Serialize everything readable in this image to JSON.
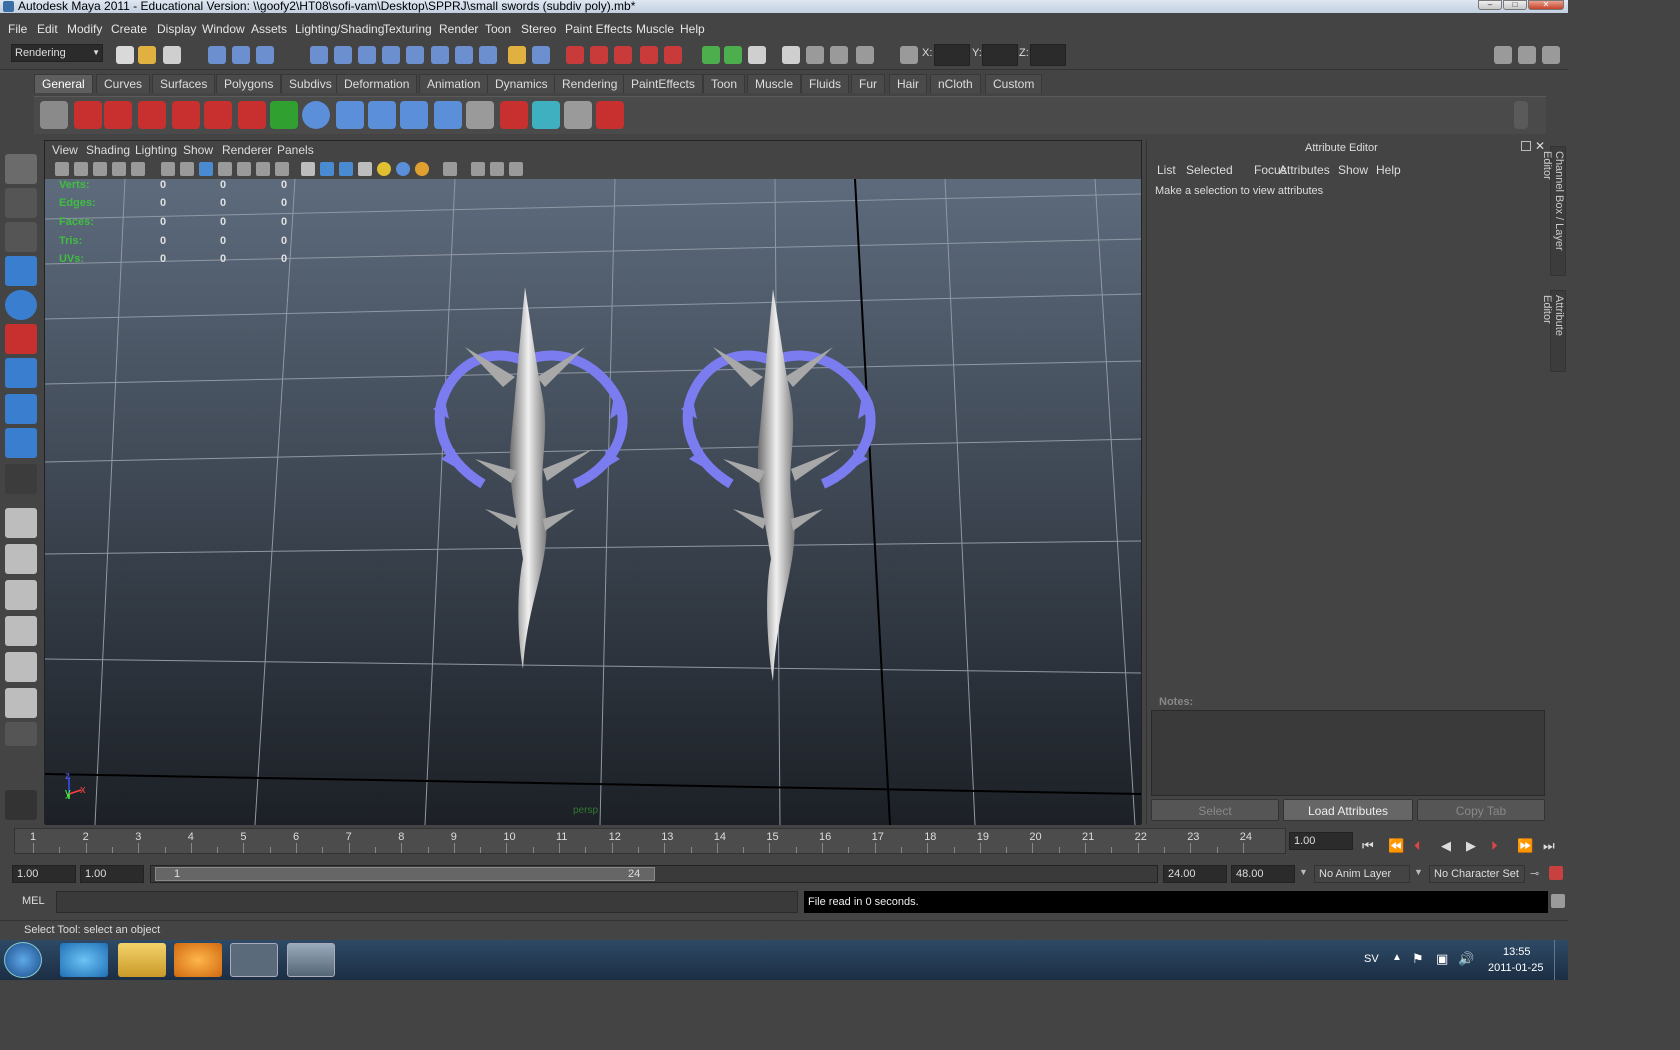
{
  "window": {
    "title": "Autodesk Maya 2011 - Educational Version: \\\\goofy2\\HT08\\sofi-vam\\Desktop\\SPPRJ\\small swords (subdiv poly).mb*"
  },
  "menu": [
    "File",
    "Edit",
    "Modify",
    "Create",
    "Display",
    "Window",
    "Assets",
    "Lighting/Shading",
    "Texturing",
    "Render",
    "Toon",
    "Stereo",
    "Paint Effects",
    "Muscle",
    "Help"
  ],
  "status_line": {
    "menu_set": "Rendering",
    "x_label": "X:",
    "y_label": "Y:",
    "z_label": "Z:"
  },
  "shelf_tabs": [
    "General",
    "Curves",
    "Surfaces",
    "Polygons",
    "Subdivs",
    "Deformation",
    "Animation",
    "Dynamics",
    "Rendering",
    "PaintEffects",
    "Toon",
    "Muscle",
    "Fluids",
    "Fur",
    "Hair",
    "nCloth",
    "Custom"
  ],
  "viewport": {
    "menu": [
      "View",
      "Shading",
      "Lighting",
      "Show",
      "Renderer",
      "Panels"
    ],
    "hud": {
      "rows": [
        {
          "label": "Verts:",
          "v1": "0",
          "v2": "0",
          "v3": "0"
        },
        {
          "label": "Edges:",
          "v1": "0",
          "v2": "0",
          "v3": "0"
        },
        {
          "label": "Faces:",
          "v1": "0",
          "v2": "0",
          "v3": "0"
        },
        {
          "label": "Tris:",
          "v1": "0",
          "v2": "0",
          "v3": "0"
        },
        {
          "label": "UVs:",
          "v1": "0",
          "v2": "0",
          "v3": "0"
        }
      ]
    },
    "camera": "persp",
    "axis": {
      "z": "z",
      "y": "y",
      "x": "x"
    }
  },
  "attribute_editor": {
    "title": "Attribute Editor",
    "menu": [
      "List",
      "Selected",
      "Focus",
      "Attributes",
      "Show",
      "Help"
    ],
    "message": "Make a selection to view attributes",
    "notes_label": "Notes:",
    "buttons": {
      "select": "Select",
      "load": "Load Attributes",
      "copy": "Copy Tab"
    }
  },
  "side_tabs": {
    "channel": "Channel Box / Layer Editor",
    "attribute": "Attribute Editor"
  },
  "timeline": {
    "ticks": [
      "1",
      "2",
      "3",
      "4",
      "5",
      "6",
      "7",
      "8",
      "9",
      "10",
      "11",
      "12",
      "13",
      "14",
      "15",
      "16",
      "17",
      "18",
      "19",
      "20",
      "21",
      "22",
      "23",
      "24"
    ],
    "current_time": "1.00"
  },
  "range": {
    "start": "1.00",
    "playback_start": "1.00",
    "slider_start": "1",
    "slider_end": "24",
    "playback_end": "24.00",
    "end": "48.00",
    "anim_layer": "No Anim Layer",
    "char_set": "No Character Set"
  },
  "command": {
    "label": "MEL",
    "result": "File read in 0 seconds."
  },
  "help_line": "Select Tool: select an object",
  "taskbar": {
    "lang": "SV",
    "time": "13:55",
    "date": "2011-01-25"
  },
  "colors": {
    "guard": "#7a7cf0",
    "blade": "#c8c8c8",
    "hud_label": "#3fbf3f"
  }
}
